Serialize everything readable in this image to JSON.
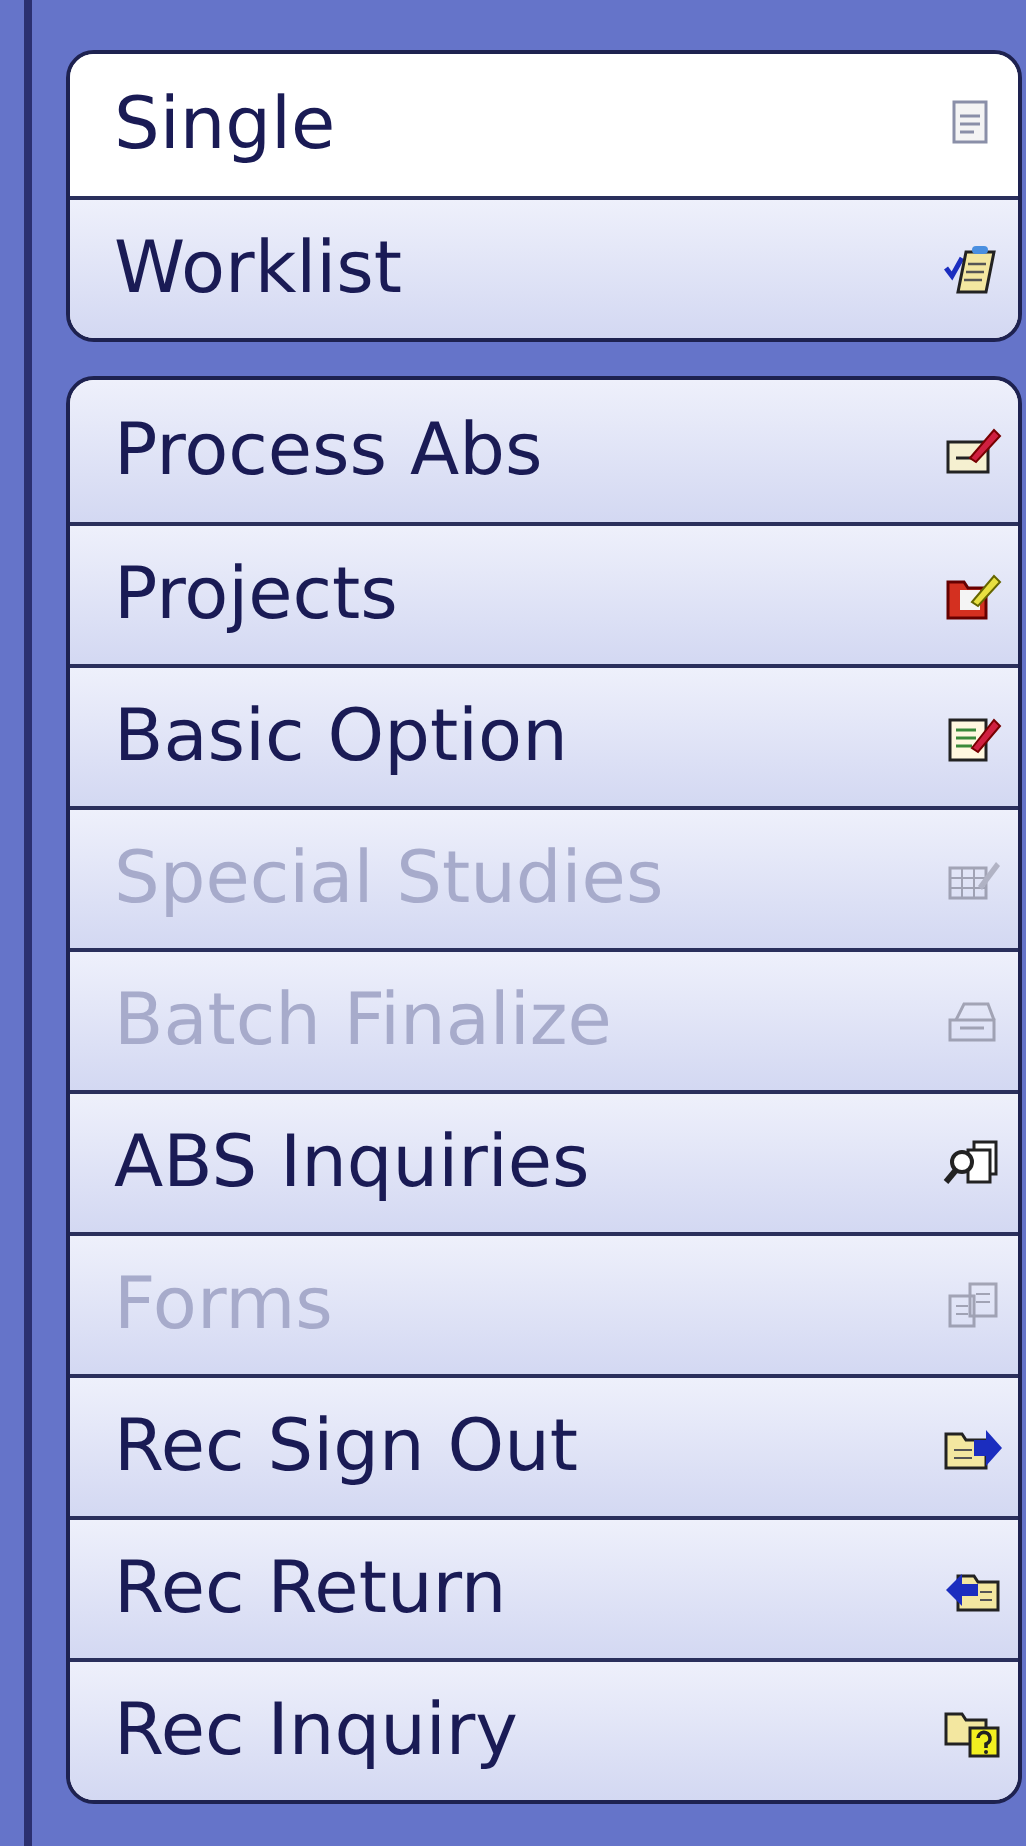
{
  "groups": [
    {
      "items": [
        {
          "label": "Single",
          "selected": true,
          "disabled": false
        },
        {
          "label": "Worklist",
          "selected": false,
          "disabled": false
        }
      ]
    },
    {
      "items": [
        {
          "label": "Process Abs",
          "selected": false,
          "disabled": false
        },
        {
          "label": "Projects",
          "selected": false,
          "disabled": false
        },
        {
          "label": "Basic Option",
          "selected": false,
          "disabled": false
        },
        {
          "label": "Special Studies",
          "selected": false,
          "disabled": true
        },
        {
          "label": "Batch Finalize",
          "selected": false,
          "disabled": true
        },
        {
          "label": "ABS Inquiries",
          "selected": false,
          "disabled": false
        },
        {
          "label": "Forms",
          "selected": false,
          "disabled": true
        },
        {
          "label": "Rec Sign Out",
          "selected": false,
          "disabled": false
        },
        {
          "label": "Rec Return",
          "selected": false,
          "disabled": false
        },
        {
          "label": "Rec Inquiry",
          "selected": false,
          "disabled": false
        }
      ]
    }
  ]
}
